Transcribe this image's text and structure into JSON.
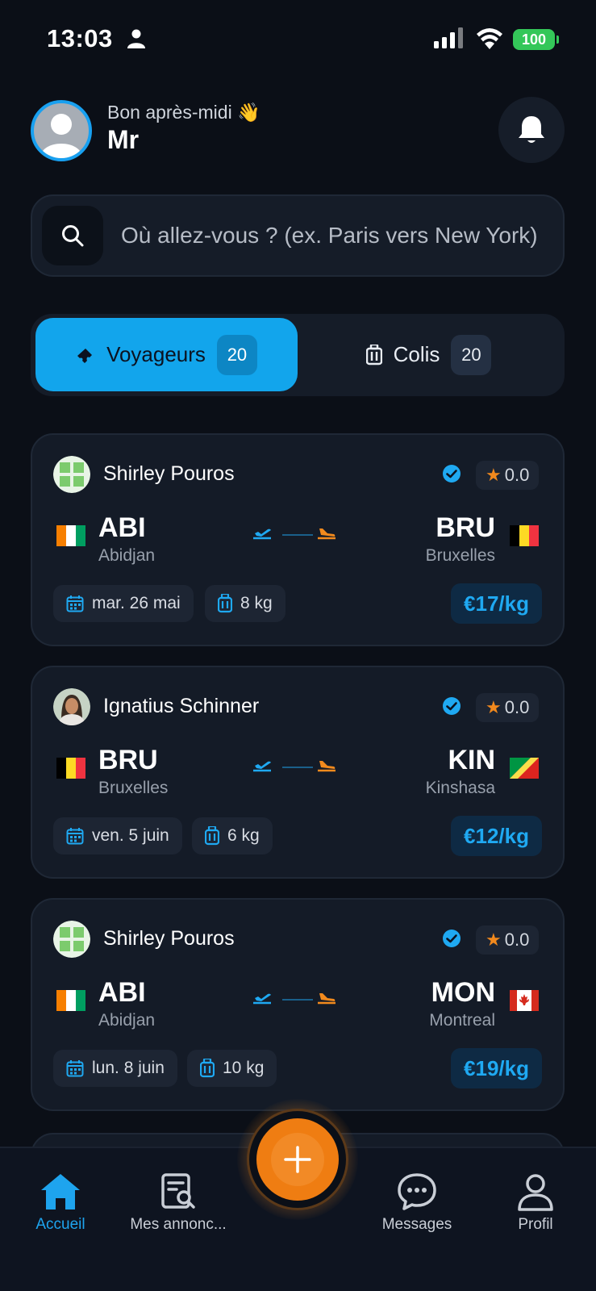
{
  "status_bar": {
    "time": "13:03",
    "battery": "100"
  },
  "header": {
    "greeting": "Bon après-midi 👋",
    "username": "Mr"
  },
  "search": {
    "placeholder": "Où allez-vous ? (ex. Paris vers New York)"
  },
  "tabs": [
    {
      "label": "Voyageurs",
      "count": "20",
      "icon": "ticket-icon",
      "active": true
    },
    {
      "label": "Colis",
      "count": "20",
      "icon": "luggage-icon",
      "active": false
    }
  ],
  "cards": [
    {
      "name": "Shirley Pouros",
      "avatar": "flag-avatar",
      "rating": "0.0",
      "from_code": "ABI",
      "from_city": "Abidjan",
      "from_flag": "ivory-coast-flag",
      "to_code": "BRU",
      "to_city": "Bruxelles",
      "to_flag": "belgium-flag",
      "date": "mar. 26 mai",
      "weight": "8 kg",
      "price": "€17/kg"
    },
    {
      "name": "Ignatius Schinner",
      "avatar": "photo-avatar",
      "rating": "0.0",
      "from_code": "BRU",
      "from_city": "Bruxelles",
      "from_flag": "belgium-flag",
      "to_code": "KIN",
      "to_city": "Kinshasa",
      "to_flag": "congo-flag",
      "date": "ven. 5 juin",
      "weight": "6 kg",
      "price": "€12/kg"
    },
    {
      "name": "Shirley Pouros",
      "avatar": "flag-avatar",
      "rating": "0.0",
      "from_code": "ABI",
      "from_city": "Abidjan",
      "from_flag": "ivory-coast-flag",
      "to_code": "MON",
      "to_city": "Montreal",
      "to_flag": "canada-flag",
      "date": "lun. 8 juin",
      "weight": "10 kg",
      "price": "€19/kg"
    }
  ],
  "nav": [
    {
      "label": "Accueil",
      "icon": "home-icon",
      "active": true
    },
    {
      "label": "Mes annonc...",
      "icon": "listings-icon",
      "active": false
    },
    {
      "label": "Messages",
      "icon": "chat-icon",
      "active": false
    },
    {
      "label": "Profil",
      "icon": "user-icon",
      "active": false
    }
  ],
  "colors": {
    "accent_blue": "#12a5ec",
    "accent_orange": "#ef7d12",
    "background": "#0b0f17",
    "card": "#141b27"
  }
}
